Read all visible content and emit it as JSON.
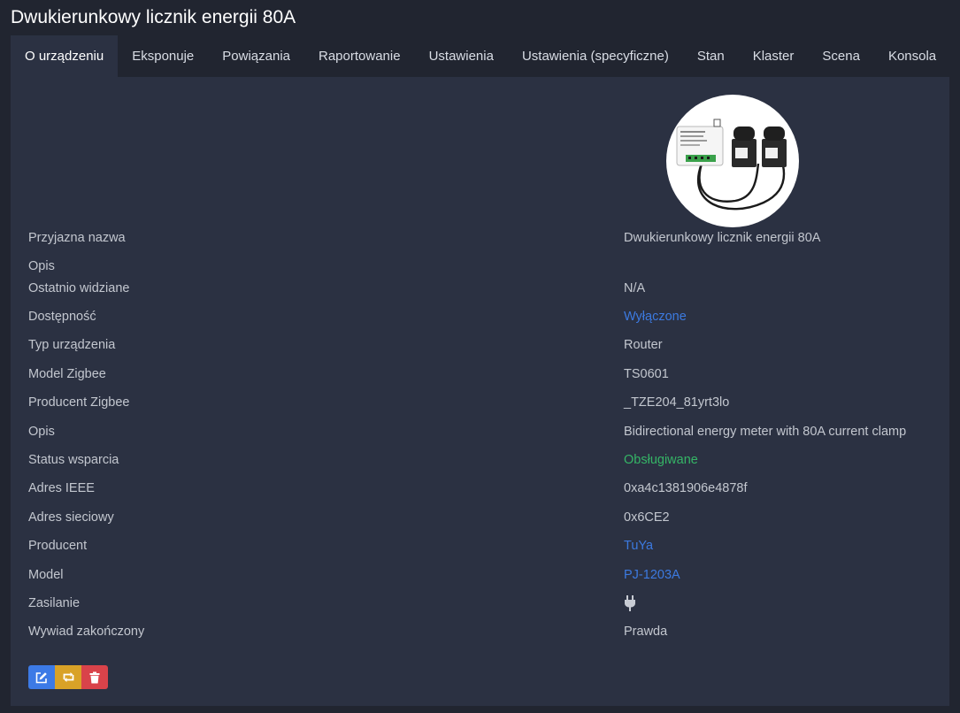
{
  "page": {
    "title": "Dwukierunkowy licznik energii 80A"
  },
  "tabs": [
    {
      "label": "O urządzeniu",
      "active": true
    },
    {
      "label": "Eksponuje"
    },
    {
      "label": "Powiązania"
    },
    {
      "label": "Raportowanie"
    },
    {
      "label": "Ustawienia"
    },
    {
      "label": "Ustawienia (specyficzne)"
    },
    {
      "label": "Stan"
    },
    {
      "label": "Klaster"
    },
    {
      "label": "Scena"
    },
    {
      "label": "Konsola"
    }
  ],
  "device": {
    "rows": [
      {
        "label": "Przyjazna nazwa",
        "value": "Dwukierunkowy licznik energii 80A"
      },
      {
        "label": "Opis",
        "value": ""
      },
      {
        "label": "Ostatnio widziane",
        "value": "N/A"
      },
      {
        "label": "Dostępność",
        "value": "Wyłączone"
      },
      {
        "label": "Typ urządzenia",
        "value": "Router"
      },
      {
        "label": "Model Zigbee",
        "value": "TS0601"
      },
      {
        "label": "Producent Zigbee",
        "value": "_TZE204_81yrt3lo"
      },
      {
        "label": "Opis",
        "value": "Bidirectional energy meter with 80A current clamp"
      },
      {
        "label": "Status wsparcia",
        "value": "Obsługiwane"
      },
      {
        "label": "Adres IEEE",
        "value": "0xa4c1381906e4878f"
      },
      {
        "label": "Adres sieciowy",
        "value": "0x6CE2"
      },
      {
        "label": "Producent",
        "value": "TuYa"
      },
      {
        "label": "Model",
        "value": "PJ-1203A"
      },
      {
        "label": "Zasilanie",
        "value": "",
        "icon": "plug-icon"
      },
      {
        "label": "Wywiad zakończony",
        "value": "Prawda"
      }
    ]
  },
  "actions": {
    "edit_icon": "edit-icon",
    "swap_icon": "swap-icon",
    "delete_icon": "trash-icon"
  },
  "colors": {
    "link": "#3c7ae0",
    "ok": "#35b566",
    "edit": "#3c7ae6",
    "swap": "#d9a227",
    "delete": "#d9434a"
  }
}
